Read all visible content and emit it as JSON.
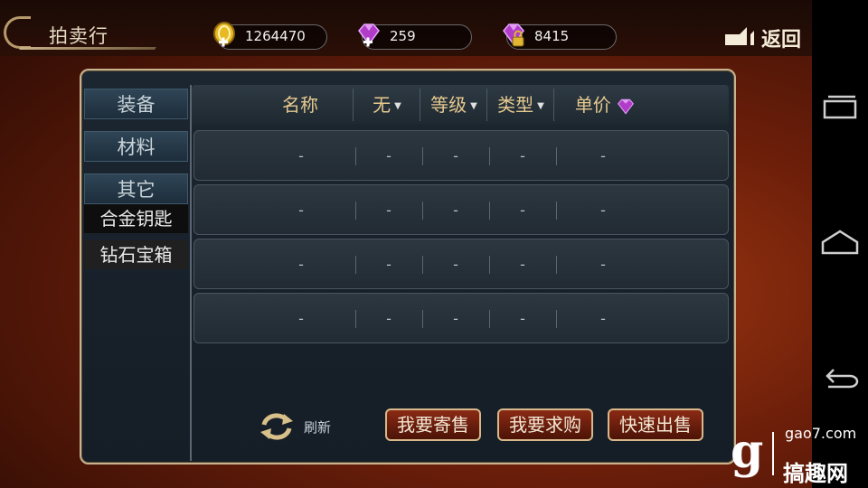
{
  "header": {
    "title": "拍卖行",
    "gold": "1264470",
    "diamonds": "259",
    "locked_diamonds": "8415",
    "back_label": "返回"
  },
  "sidebar": {
    "tabs": [
      "装备",
      "材料",
      "其它"
    ],
    "subitems": [
      "合金钥匙",
      "钻石宝箱"
    ],
    "selected_subitem": "合金钥匙"
  },
  "table": {
    "columns": [
      "名称",
      "无",
      "等级",
      "类型",
      "单价"
    ],
    "rows": [
      [
        "-",
        "-",
        "-",
        "-",
        "-"
      ],
      [
        "-",
        "-",
        "-",
        "-",
        "-"
      ],
      [
        "-",
        "-",
        "-",
        "-",
        "-"
      ],
      [
        "-",
        "-",
        "-",
        "-",
        "-"
      ]
    ]
  },
  "footer": {
    "refresh_label": "刷新",
    "buttons": [
      "我要寄售",
      "我要求购",
      "快速出售"
    ]
  },
  "watermark": {
    "logo_letter": "g",
    "url": "gao7.com",
    "brand": "搞趣网"
  },
  "colors": {
    "header_text": "#e6c98f",
    "button_red": "#8a2a14",
    "border_gold": "#c7b38f",
    "diamond_purple": "#b03cc8"
  }
}
